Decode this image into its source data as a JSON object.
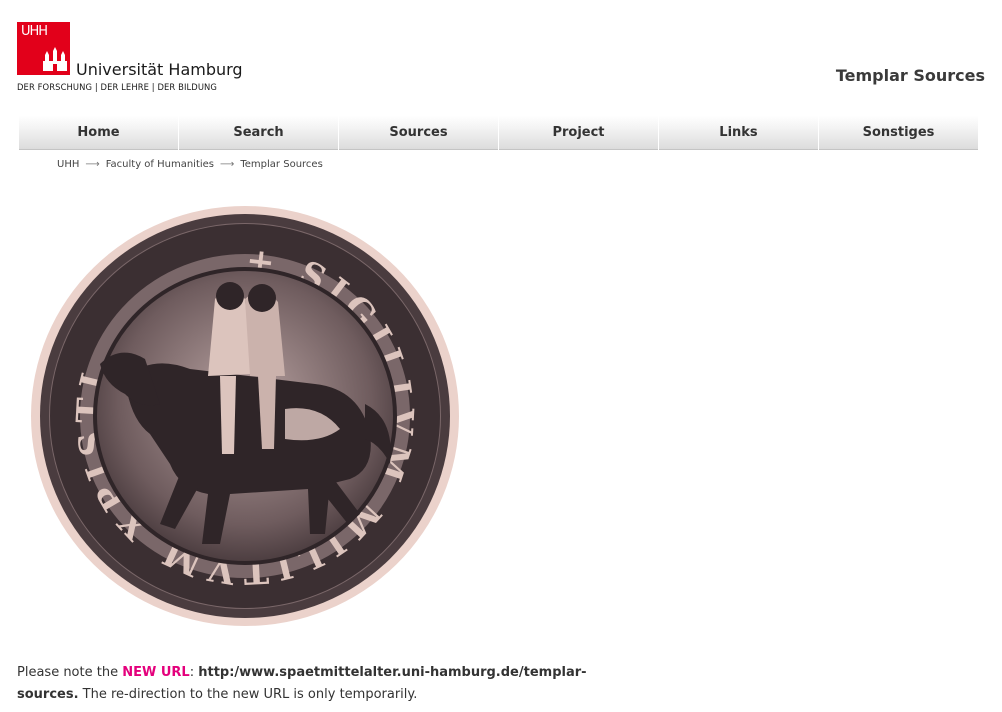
{
  "header": {
    "logo_text": "UHH",
    "university_name": "Universität Hamburg",
    "tagline": "DER FORSCHUNG | DER LEHRE | DER BILDUNG",
    "site_title": "Templar Sources"
  },
  "nav": {
    "items": [
      {
        "label": "Home"
      },
      {
        "label": "Search"
      },
      {
        "label": "Sources"
      },
      {
        "label": "Project"
      },
      {
        "label": "Links"
      },
      {
        "label": "Sonstiges"
      }
    ]
  },
  "breadcrumb": {
    "separator": "⟶",
    "items": [
      {
        "label": "UHH"
      },
      {
        "label": "Faculty of Humanities"
      },
      {
        "label": "Templar Sources"
      }
    ]
  },
  "seal": {
    "inscription": "+ SIGILLVM MILITVM XPISTI",
    "colors": {
      "ground": "#ebd2cb",
      "dark": "#3b2f32",
      "mid": "#6b5a5c"
    }
  },
  "notice": {
    "prefix": "Please note the ",
    "highlight": "NEW URL",
    "colon": ": ",
    "url": "http:/www.spaetmittelalter.uni-hamburg.de/templar-sources.",
    "suffix": " The re-direction to the new URL is only temporarily."
  },
  "colors": {
    "brand_red": "#e2001a",
    "accent_pink": "#e4007c",
    "text": "#333333"
  }
}
